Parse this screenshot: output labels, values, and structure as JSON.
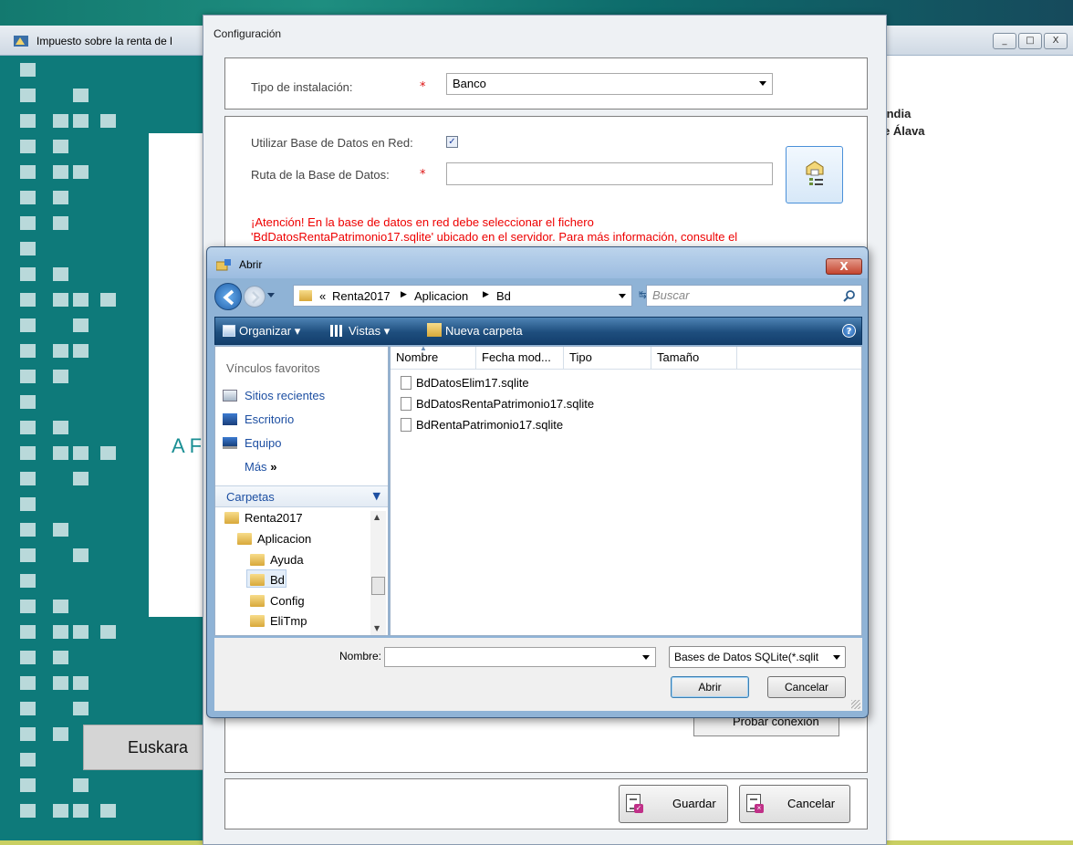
{
  "main_window": {
    "title": "Impuesto sobre la renta de l",
    "big_letter": "A F",
    "language_button": "Euskara",
    "right_text_1": "ındia",
    "right_text_2": "e Álava",
    "controls": [
      "_",
      "□",
      "X"
    ]
  },
  "config_dialog": {
    "title": "Configuración",
    "install_type_label": "Tipo de instalación:",
    "install_type_value": "Banco",
    "use_network_db_label": "Utilizar Base de Datos en Red:",
    "use_network_db_checked": true,
    "db_path_label": "Ruta de la Base de Datos:",
    "db_path_value": "",
    "required_marker": "*",
    "warning_line_1": "¡Atención! En la base de datos en red debe seleccionar el fichero",
    "warning_line_2": "'BdDatosRentaPatrimonio17.sqlite' ubicado en el servidor. Para más información, consulte el",
    "test_connection_button": "Probar conexión",
    "save_button": "Guardar",
    "cancel_button": "Cancelar"
  },
  "open_dialog": {
    "title": "Abrir",
    "close_glyph": "X",
    "breadcrumb_prefix": "«",
    "breadcrumb": [
      "Renta2017",
      "Aplicacion",
      "Bd"
    ],
    "search_placeholder": "Buscar",
    "toolbar": {
      "organize": "Organizar",
      "views": "Vistas",
      "new_folder": "Nueva carpeta"
    },
    "favorites_header": "Vínculos favoritos",
    "favorites": [
      {
        "label": "Sitios recientes",
        "icon": "recent-places-icon"
      },
      {
        "label": "Escritorio",
        "icon": "desktop-icon"
      },
      {
        "label": "Equipo",
        "icon": "computer-icon"
      }
    ],
    "more_label": "Más",
    "more_glyph": "»",
    "folders_header": "Carpetas",
    "folder_tree": [
      "Renta2017",
      "Aplicacion",
      "Ayuda",
      "Bd",
      "Config",
      "EliTmp"
    ],
    "columns": [
      "Nombre",
      "Fecha mod...",
      "Tipo",
      "Tamaño"
    ],
    "files": [
      "BdDatosElim17.sqlite",
      "BdDatosRentaPatrimonio17.sqlite",
      "BdRentaPatrimonio17.sqlite"
    ],
    "filename_label": "Nombre:",
    "filename_value": "",
    "filter_value": "Bases de Datos SQLite(*.sqlit",
    "open_button": "Abrir",
    "cancel_button": "Cancelar"
  },
  "colors": {
    "teal_panel": "#0e7a7a",
    "warning_red": "#e00000",
    "link_blue": "#1d4fa2",
    "toolbar_blue": "#1e4e7e"
  }
}
